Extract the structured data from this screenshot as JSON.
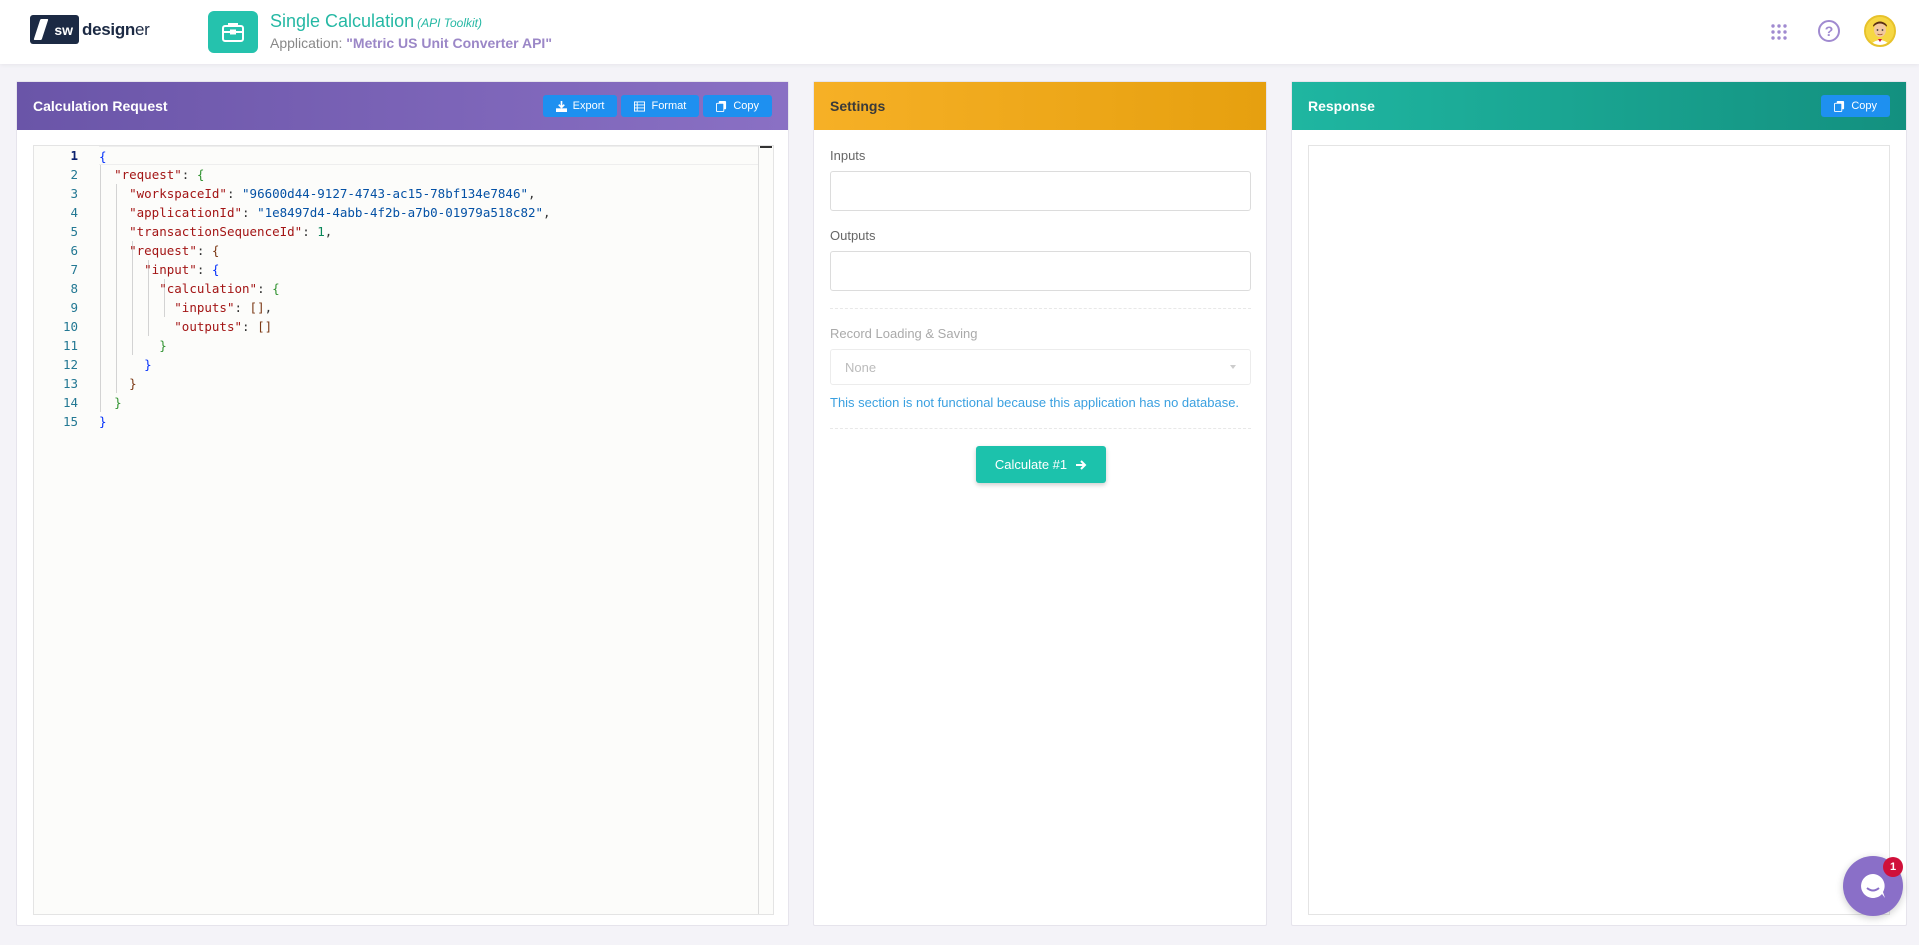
{
  "header": {
    "logo_badge": "sw",
    "logo_word": "design",
    "logo_word_tail": "er",
    "app_title": "Single Calculation",
    "app_title_note": "(API Toolkit)",
    "app_label": "Application:",
    "app_name": "\"Metric US Unit Converter API\"",
    "help_glyph": "?"
  },
  "request_panel": {
    "title": "Calculation Request",
    "export_label": "Export",
    "format_label": "Format",
    "copy_label": "Copy"
  },
  "editor": {
    "line_numbers": [
      "1",
      "2",
      "3",
      "4",
      "5",
      "6",
      "7",
      "8",
      "9",
      "10",
      "11",
      "12",
      "13",
      "14",
      "15"
    ],
    "values": {
      "workspaceId": "\"96600d44-9127-4743-ac15-78bf134e7846\"",
      "applicationId": "\"1e8497d4-4abb-4f2b-a7b0-01979a518c82\"",
      "transactionSequenceId": "1"
    }
  },
  "settings_panel": {
    "title": "Settings",
    "inputs_label": "Inputs",
    "inputs_value": "",
    "outputs_label": "Outputs",
    "outputs_value": "",
    "record_label": "Record Loading & Saving",
    "record_value": "None",
    "note": "This section is not functional because this application has no database.",
    "calculate_label": "Calculate #1"
  },
  "response_panel": {
    "title": "Response",
    "copy_label": "Copy"
  },
  "chat": {
    "badge_count": "1"
  },
  "colors": {
    "request_header": "#7b63b8",
    "settings_header": "#f0aa1e",
    "response_header": "#1aa893",
    "accent_button": "#1e90f0",
    "calculate_button": "#1cc2ac"
  }
}
